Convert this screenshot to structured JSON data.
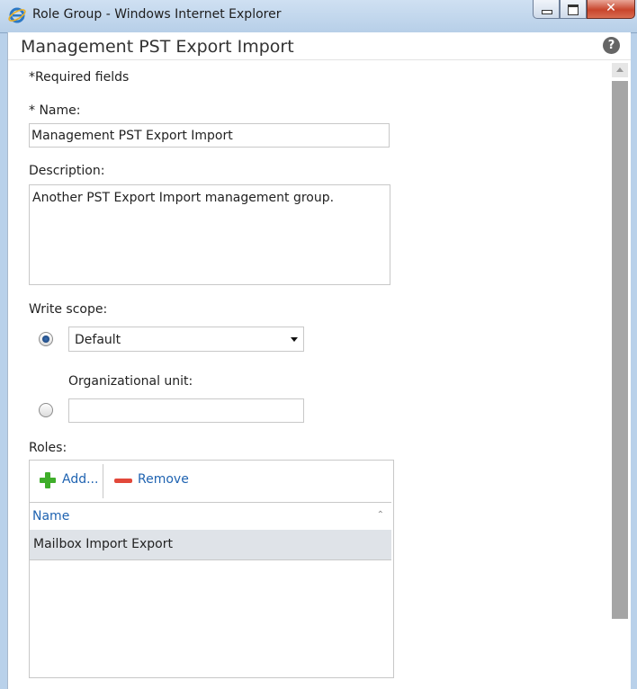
{
  "window": {
    "title": "Role Group - Windows Internet Explorer",
    "close_glyph": "✕"
  },
  "page": {
    "title": "Management PST Export Import",
    "help_glyph": "?"
  },
  "form": {
    "required_note": "*Required fields",
    "name_label": "* Name:",
    "name_value": "Management PST Export Import",
    "description_label": "Description:",
    "description_value": "Another PST Export Import management group.",
    "write_scope_label": "Write scope:",
    "write_scope_selected": "Default",
    "org_unit_label": "Organizational unit:",
    "org_unit_value": "",
    "roles_label": "Roles:"
  },
  "roles": {
    "add_label": "Add...",
    "remove_label": "Remove",
    "column_header": "Name",
    "rows": [
      "Mailbox Import Export"
    ]
  },
  "colors": {
    "link": "#1f63b1",
    "selected_row": "#dfe3e8",
    "remove": "#e2483a",
    "add": "#3fae2a"
  }
}
